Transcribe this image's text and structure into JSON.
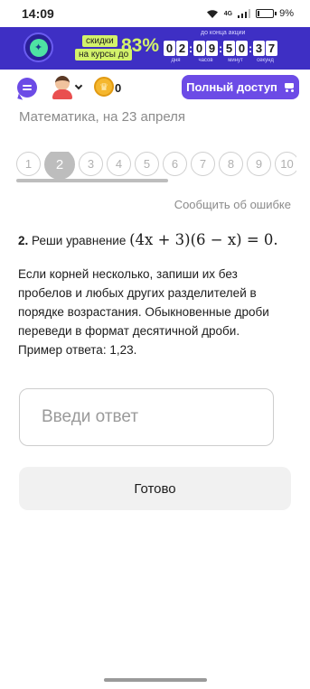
{
  "status_bar": {
    "time": "14:09",
    "network": "4G",
    "battery": "9%",
    "battery_fraction": 0.09
  },
  "promo": {
    "tag_line1": "скидки",
    "tag_line2": "на курсы до",
    "percent": "83%",
    "timer_caption": "до конца акции",
    "timer": [
      {
        "digits": [
          "0",
          "2"
        ],
        "label": "дня"
      },
      {
        "digits": [
          "0",
          "9"
        ],
        "label": "часов"
      },
      {
        "digits": [
          "5",
          "0"
        ],
        "label": "минут"
      },
      {
        "digits": [
          "3",
          "7"
        ],
        "label": "секунд"
      }
    ],
    "colors": {
      "background": "#3e2fc4",
      "accent": "#d3f26a"
    }
  },
  "header": {
    "coin_count": "0",
    "full_access_label": "Полный доступ",
    "accent": "#6c4be6"
  },
  "subject_title": "Математика, на 23 апреля",
  "question_nav": {
    "items": [
      "1",
      "2",
      "3",
      "4",
      "5",
      "6",
      "7",
      "8",
      "9",
      "10"
    ],
    "active_index": 1
  },
  "report_error_label": "Сообщить об ошибке",
  "question": {
    "number": "2.",
    "prompt": "Реши уравнение",
    "equation": "(4x + 3)(6 − x) = 0.",
    "instructions": "Если корней несколько, запиши их без пробелов и любых других разделителей в порядке возрастания. Обыкновенные дроби переведи в формат десятичной дроби. Пример ответа: 1,23."
  },
  "answer": {
    "placeholder": "Введи ответ",
    "value": ""
  },
  "done_label": "Готово"
}
